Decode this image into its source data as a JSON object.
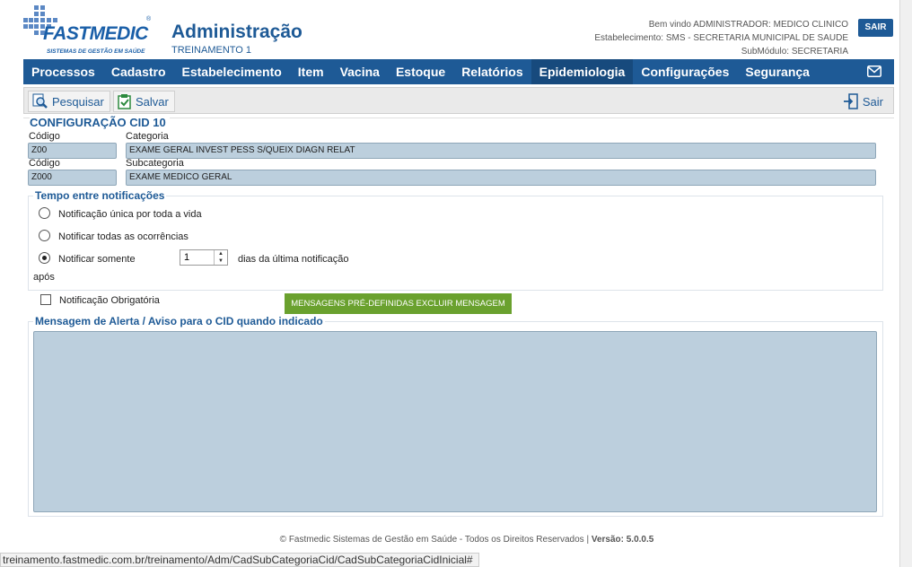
{
  "brand": {
    "name": "FASTMEDIC",
    "tagline": "SISTEMAS DE GESTÃO EM SAÚDE",
    "registered": "®"
  },
  "header": {
    "title": "Administração",
    "subtitle": "TREINAMENTO 1",
    "welcome": "Bem vindo ADMINISTRADOR: MEDICO CLINICO",
    "establishment": "Estabelecimento: SMS - SECRETARIA MUNICIPAL DE SAUDE",
    "submodule": "SubMódulo: SECRETARIA",
    "logout_label": "SAIR"
  },
  "menu": {
    "items": [
      "Processos",
      "Cadastro",
      "Estabelecimento",
      "Item",
      "Vacina",
      "Estoque",
      "Relatórios",
      "Epidemiologia",
      "Configurações",
      "Segurança"
    ],
    "active": "Epidemiologia"
  },
  "toolbar": {
    "search_label": "Pesquisar",
    "save_label": "Salvar",
    "exit_label": "Sair"
  },
  "form": {
    "title": "CONFIGURAÇÃO CID 10",
    "code_label": "Código",
    "category_label": "Categoria",
    "subcategory_label": "Subcategoria",
    "category_code": "Z00",
    "category_value": "EXAME GERAL INVEST PESS S/QUEIX DIAGN RELAT",
    "subcategory_code": "Z000",
    "subcategory_value": "EXAME MEDICO GERAL",
    "notification_legend": "Tempo entre notificações",
    "option_once": "Notificação única por toda a vida",
    "option_all": "Notificar todas as ocorrências",
    "option_only": "Notificar somente",
    "option_only_suffix": "dias da última notificação",
    "option_only_after": "após",
    "days_value": "1",
    "selected_option": "only",
    "mandatory_label": "Notificação Obrigatória",
    "mandatory_checked": false,
    "predefined_button": "MENSAGENS PRÉ-DEFINIDAS  EXCLUIR MENSAGEM",
    "message_legend": "Mensagem de Alerta / Aviso para o CID quando indicado",
    "message_value": ""
  },
  "footer": {
    "copyright": "© Fastmedic Sistemas de Gestão em Saúde - Todos os Direitos Reservados | ",
    "version_label": "Versão: 5.0.0.5"
  },
  "status_url": "treinamento.fastmedic.com.br/treinamento/Adm/CadSubCategoriaCid/CadSubCategoriaCidInicial#",
  "colors": {
    "primary": "#1e5a96",
    "active_menu": "#174a7d",
    "field_bg": "#bccfdd",
    "green": "#6aa12e"
  }
}
